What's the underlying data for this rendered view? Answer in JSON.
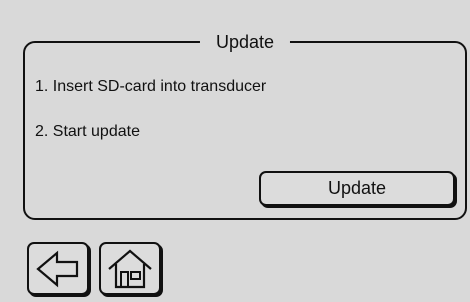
{
  "panel": {
    "title": "Update",
    "steps": [
      "1. Insert SD-card into transducer",
      "2. Start update"
    ],
    "action_label": "Update"
  },
  "navigation": {
    "back_icon": "left-arrow-icon",
    "home_icon": "home-icon"
  },
  "colors": {
    "background": "#d9d9d9",
    "foreground": "#111111"
  }
}
